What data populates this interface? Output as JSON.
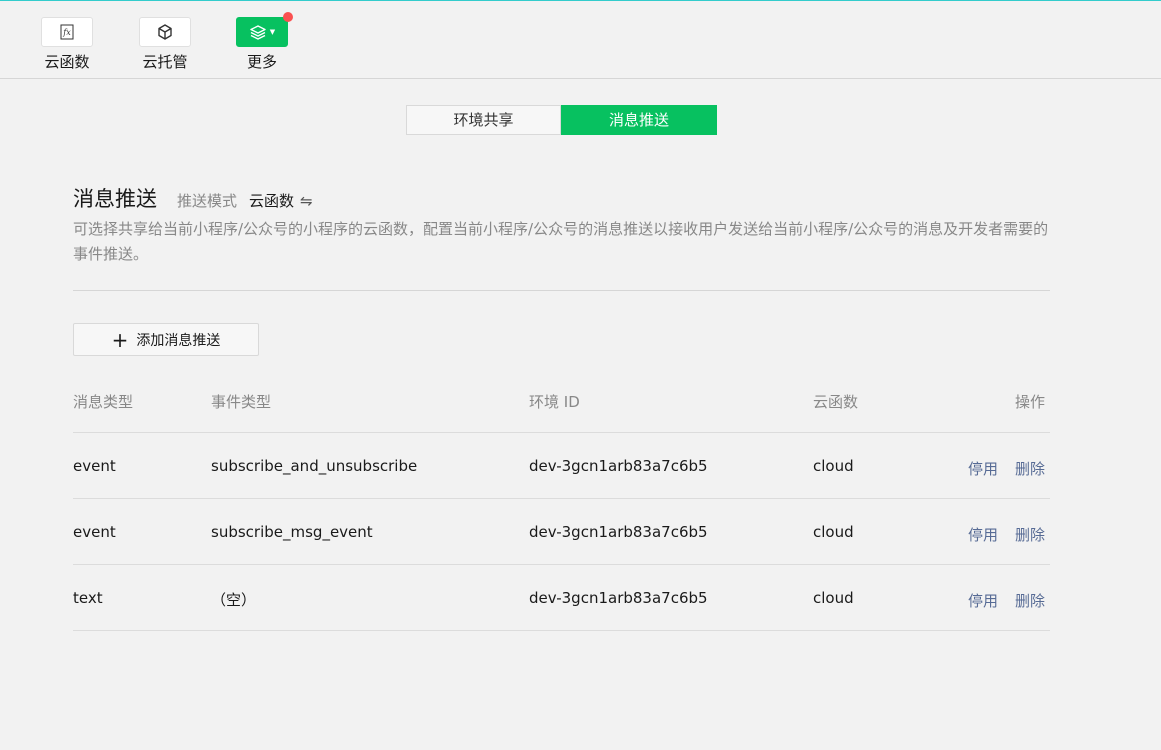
{
  "toolbar": {
    "items": [
      {
        "label": "云函数",
        "icon": "fx-icon"
      },
      {
        "label": "云托管",
        "icon": "cube-icon"
      },
      {
        "label": "更多",
        "icon": "layers-icon"
      }
    ]
  },
  "tabs": {
    "env_share": "环境共享",
    "message_push": "消息推送",
    "active": "消息推送"
  },
  "section": {
    "title": "消息推送",
    "mode_label": "推送模式",
    "mode_value": "云函数",
    "swap_symbol": "⇋",
    "description": "可选择共享给当前小程序/公众号的小程序的云函数，配置当前小程序/公众号的消息推送以接收用户发送给当前小程序/公众号的消息及开发者需要的事件推送。"
  },
  "add_button": {
    "icon": "+",
    "label": "添加消息推送"
  },
  "table": {
    "headers": {
      "msg_type": "消息类型",
      "event_type": "事件类型",
      "env_id": "环境 ID",
      "func": "云函数",
      "ops": "操作"
    },
    "rows": [
      {
        "msg_type": "event",
        "event_type": "subscribe_and_unsubscribe",
        "env_id": "dev-3gcn1arb83a7c6b5",
        "func": "cloud",
        "disable": "停用",
        "delete": "删除"
      },
      {
        "msg_type": "event",
        "event_type": "subscribe_msg_event",
        "env_id": "dev-3gcn1arb83a7c6b5",
        "func": "cloud",
        "disable": "停用",
        "delete": "删除"
      },
      {
        "msg_type": "text",
        "event_type": "（空）",
        "env_id": "dev-3gcn1arb83a7c6b5",
        "func": "cloud",
        "disable": "停用",
        "delete": "删除"
      }
    ]
  },
  "colors": {
    "accent": "#07c160",
    "link": "#576b95",
    "badge": "#fa5151"
  }
}
